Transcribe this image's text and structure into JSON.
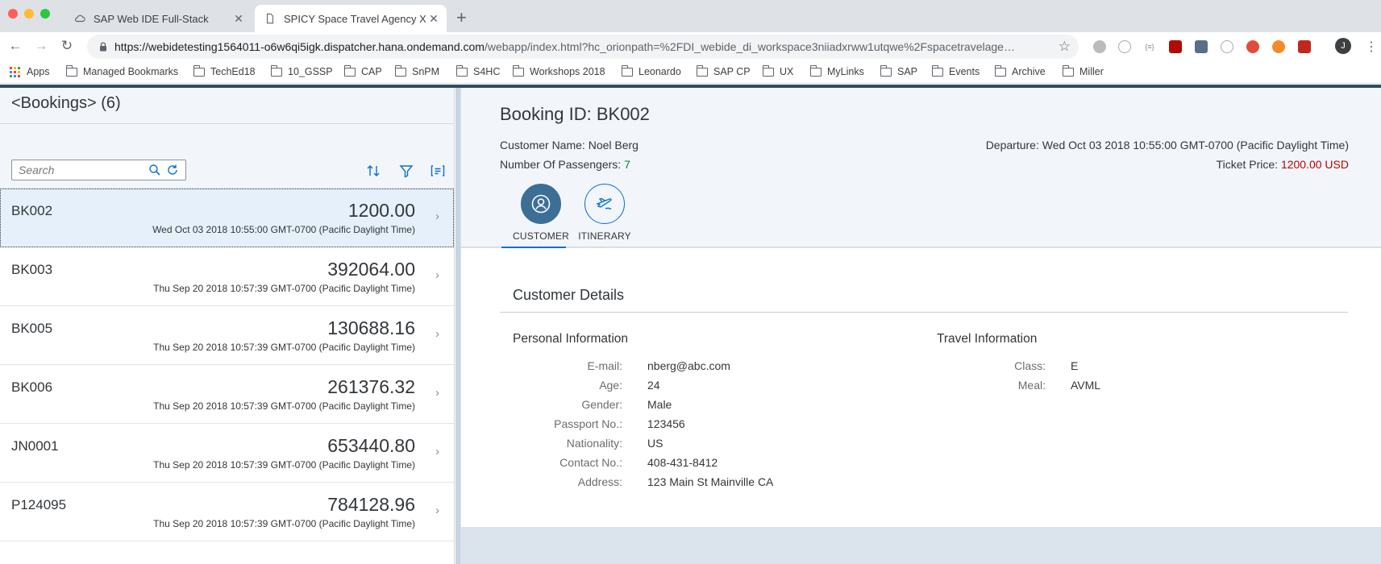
{
  "browser": {
    "tabs": [
      {
        "title": "SAP Web IDE Full-Stack",
        "active": false
      },
      {
        "title": "SPICY Space Travel Agency XX",
        "active": true
      }
    ],
    "url_host": "https://webidetesting1564011-o6w6qi5igk.dispatcher.hana.ondemand.com",
    "url_path": "/webapp/index.html?hc_orionpath=%2FDI_webide_di_workspace3niiadxrww1utqwe%2Fspacetravelage…",
    "profile_initial": "J",
    "bookmarks": [
      "Apps",
      "Managed Bookmarks",
      "TechEd18",
      "10_GSSP",
      "CAP",
      "SnPM",
      "S4HC",
      "Workshops 2018",
      "Leonardo",
      "SAP CP",
      "UX",
      "MyLinks",
      "SAP",
      "Events",
      "Archive",
      "Miller"
    ]
  },
  "master": {
    "title": "<Bookings> (6)",
    "search_placeholder": "Search",
    "items": [
      {
        "id": "BK002",
        "amount": "1200.00",
        "date": "Wed Oct 03 2018 10:55:00 GMT-0700 (Pacific Daylight Time)",
        "selected": true
      },
      {
        "id": "BK003",
        "amount": "392064.00",
        "date": "Thu Sep 20 2018 10:57:39 GMT-0700 (Pacific Daylight Time)",
        "selected": false
      },
      {
        "id": "BK005",
        "amount": "130688.16",
        "date": "Thu Sep 20 2018 10:57:39 GMT-0700 (Pacific Daylight Time)",
        "selected": false
      },
      {
        "id": "BK006",
        "amount": "261376.32",
        "date": "Thu Sep 20 2018 10:57:39 GMT-0700 (Pacific Daylight Time)",
        "selected": false
      },
      {
        "id": "JN0001",
        "amount": "653440.80",
        "date": "Thu Sep 20 2018 10:57:39 GMT-0700 (Pacific Daylight Time)",
        "selected": false
      },
      {
        "id": "P124095",
        "amount": "784128.96",
        "date": "Thu Sep 20 2018 10:57:39 GMT-0700 (Pacific Daylight Time)",
        "selected": false
      }
    ]
  },
  "detail": {
    "title": "Booking ID: BK002",
    "customer_name_label": "Customer Name:",
    "customer_name": "Noel Berg",
    "passengers_label": "Number Of Passengers:",
    "passengers": "7",
    "departure_label": "Departure:",
    "departure": "Wed Oct 03 2018 10:55:00 GMT-0700 (Pacific Daylight Time)",
    "price_label": "Ticket Price:",
    "price": "1200.00 USD",
    "anchors": [
      {
        "label": "CUSTOMER",
        "icon": "customer-icon",
        "selected": true
      },
      {
        "label": "ITINERARY",
        "icon": "flight-icon",
        "selected": false
      }
    ],
    "section_title": "Customer Details",
    "personal": {
      "title": "Personal Information",
      "rows": [
        {
          "label": "E-mail:",
          "value": "nberg@abc.com"
        },
        {
          "label": "Age:",
          "value": "24"
        },
        {
          "label": "Gender:",
          "value": "Male"
        },
        {
          "label": "Passport No.:",
          "value": "123456"
        },
        {
          "label": "Nationality:",
          "value": "US"
        },
        {
          "label": "Contact No.:",
          "value": "408-431-8412"
        },
        {
          "label": "Address:",
          "value": "123 Main St Mainville CA"
        }
      ]
    },
    "travel": {
      "title": "Travel Information",
      "rows": [
        {
          "label": "Class:",
          "value": "E"
        },
        {
          "label": "Meal:",
          "value": "AVML"
        }
      ]
    }
  },
  "colors": {
    "accent": "#0a6ed1",
    "positive": "#107e3e",
    "negative": "#bb0000",
    "shell": "#354a5f"
  }
}
